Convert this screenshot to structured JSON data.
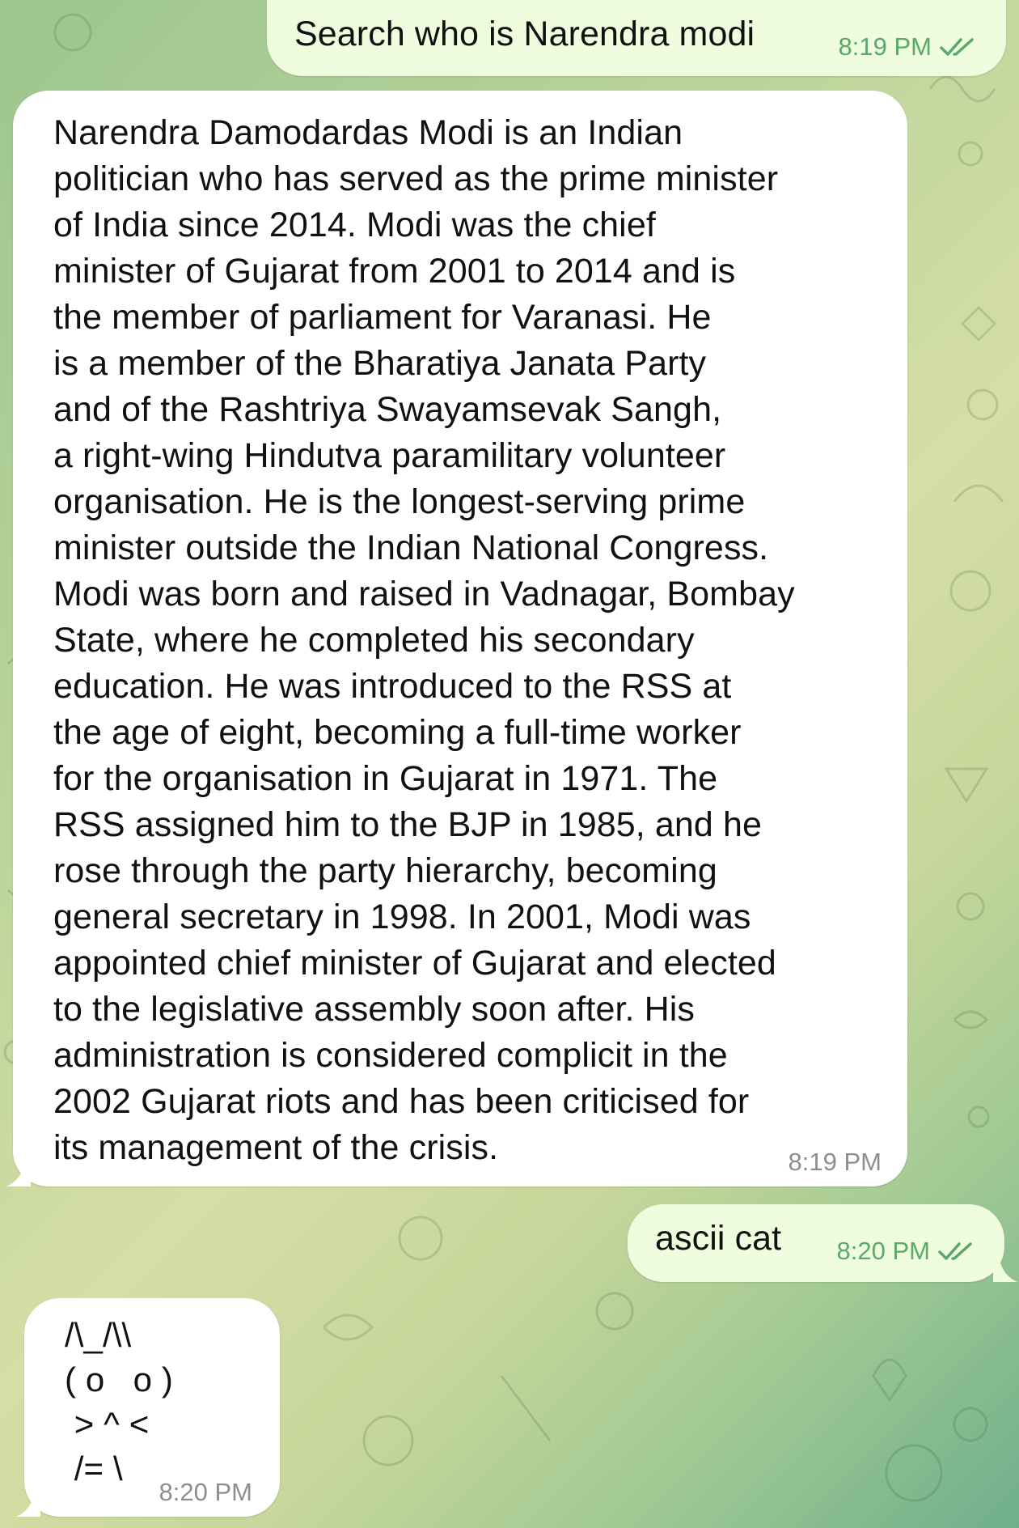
{
  "messages": [
    {
      "direction": "outgoing",
      "text": "Search who is Narendra modi",
      "time": "8:19 PM",
      "status": "read",
      "status_icon": "double-check-icon"
    },
    {
      "direction": "incoming",
      "text": "Narendra Damodardas Modi is an Indian\npolitician who has served as the prime minister\nof India since 2014. Modi was the chief\nminister of Gujarat from 2001 to 2014 and is\nthe member of parliament for Varanasi. He\nis a member of the Bharatiya Janata Party\nand of the Rashtriya Swayamsevak Sangh,\na right-wing Hindutva paramilitary volunteer\norganisation. He is the longest-serving prime\nminister outside the Indian National Congress.\nModi was born and raised in Vadnagar, Bombay\nState, where he completed his secondary\neducation. He was introduced to the RSS at\nthe age of eight, becoming a full-time worker\nfor the organisation in Gujarat in 1971. The\nRSS assigned him to the BJP in 1985, and he\nrose through the party hierarchy, becoming\ngeneral secretary in 1998. In 2001, Modi was\nappointed chief minister of Gujarat and elected\nto the legislative assembly soon after. His\nadministration is considered complicit in the\n2002 Gujarat riots and has been criticised for\nits management of the crisis.",
      "time": "8:19 PM"
    },
    {
      "direction": "outgoing",
      "text": "ascii cat",
      "time": "8:20 PM",
      "status": "read",
      "status_icon": "double-check-icon"
    },
    {
      "direction": "incoming",
      "text": "/\\_/\\\\\n( o   o )\n > ^ <\n /= \\",
      "time": "8:20 PM"
    }
  ],
  "colors": {
    "outgoing_bubble": "#effdde",
    "incoming_bubble": "#ffffff",
    "outgoing_meta": "#5aa86a",
    "incoming_meta": "#8e8e8e",
    "background_start": "#9cc58f",
    "background_end": "#6faf8c"
  }
}
